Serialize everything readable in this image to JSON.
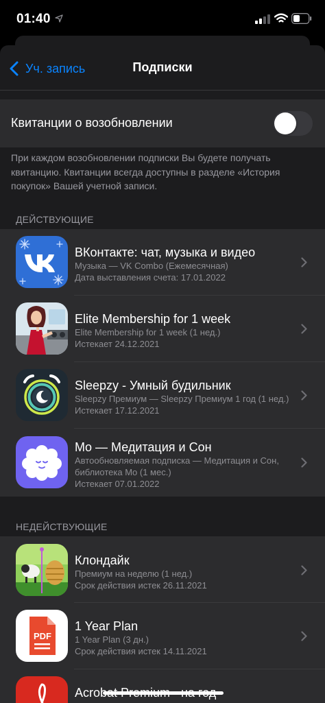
{
  "status_bar": {
    "time": "01:40"
  },
  "nav": {
    "back_label": "Уч. запись",
    "title": "Подписки"
  },
  "receipts": {
    "label": "Квитанции о возобновлении",
    "enabled": false,
    "footnote": "При каждом возобновлении подписки Вы будете получать квитанцию. Квитанции всегда доступны в разделе «История покупок» Вашей учетной записи."
  },
  "active": {
    "header": "ДЕЙСТВУЮЩИЕ",
    "items": [
      {
        "icon": "vk-app-icon",
        "title": "ВКонтакте: чат, музыка и видео",
        "line1": "Музыка — VK Combo (Ежемесячная)",
        "line2": "Дата выставления счета: 17.01.2022"
      },
      {
        "icon": "elite-game-app-icon",
        "title": "Elite Membership for 1 week",
        "line1": "Elite Membership for 1 week (1 нед.)",
        "line2": "Истекает 24.12.2021"
      },
      {
        "icon": "sleepzy-alarm-app-icon",
        "title": "Sleepzy - Умный будильник",
        "line1": "Sleepzy Премиум — Sleepzy Премиум 1 год (1 нед.)",
        "line2": "Истекает 17.12.2021"
      },
      {
        "icon": "mo-cloud-app-icon",
        "title": "Mo — Медитация и Сон",
        "line1": "Автообновляемая подписка — Медитация и Сон,",
        "line2": "библиотека Mo (1 мес.)",
        "line3": "Истекает 07.01.2022"
      }
    ]
  },
  "inactive": {
    "header": "НЕДЕЙСТВУЮЩИЕ",
    "items": [
      {
        "icon": "klondike-game-app-icon",
        "title": "Клондайк",
        "line1": "Премиум на неделю (1 нед.)",
        "line2": "Срок действия истек 26.11.2021"
      },
      {
        "icon": "pdf-app-icon",
        "title": "1 Year Plan",
        "line1": "1 Year Plan (3 дн.)",
        "line2": "Срок действия истек 14.11.2021"
      },
      {
        "icon": "acrobat-app-icon",
        "title": "Acrobat Premium - на год"
      }
    ]
  },
  "colors": {
    "accent": "#0a84ff",
    "background": "#000000",
    "cell": "#2c2c2e",
    "secondary_text": "#98989f"
  }
}
